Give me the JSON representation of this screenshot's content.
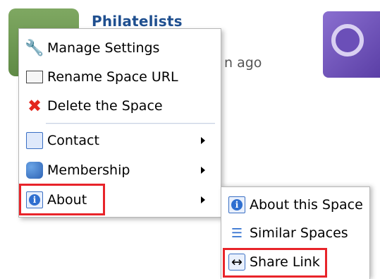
{
  "background": {
    "space_title": "Philatelists",
    "space_meta": "n ago"
  },
  "main_menu": {
    "items": [
      {
        "label": "Manage Settings",
        "icon": "wrench-icon"
      },
      {
        "label": "Rename Space URL",
        "icon": "rename-icon"
      },
      {
        "label": "Delete the Space",
        "icon": "delete-x-icon"
      },
      {
        "label": "Contact",
        "icon": "contact-card-icon",
        "submenu": true
      },
      {
        "label": "Membership",
        "icon": "membership-icon",
        "submenu": true
      },
      {
        "label": "About",
        "icon": "about-info-icon",
        "submenu": true,
        "highlighted": true
      }
    ]
  },
  "sub_menu": {
    "items": [
      {
        "label": "About this Space",
        "icon": "about-info-icon"
      },
      {
        "label": "Similar Spaces",
        "icon": "similar-spaces-icon"
      },
      {
        "label": "Share Link",
        "icon": "share-link-icon",
        "highlighted": true
      }
    ]
  },
  "colors": {
    "highlight_border": "#e8242a",
    "title_link": "#1f4f8f"
  }
}
